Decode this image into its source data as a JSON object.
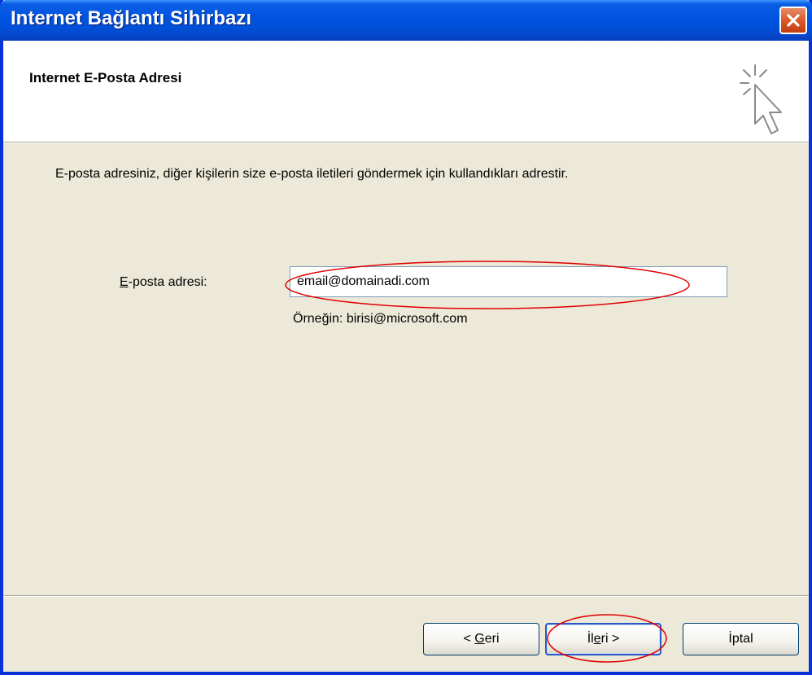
{
  "window": {
    "title": "Internet Bağlantı Sihirbazı",
    "accent_color": "#0054e3",
    "close_icon": "close-icon"
  },
  "header": {
    "title": "Internet E-Posta Adresi",
    "icon": "wizard-cursor-icon"
  },
  "body": {
    "description": "E-posta adresiniz, diğer kişilerin size e-posta iletileri göndermek için kullandıkları adrestir.",
    "email_label": "E-posta adresi:",
    "email_value": "email@domainadi.com",
    "example": "Örneğin: birisi@microsoft.com",
    "highlight_color": "#e00000"
  },
  "buttons": {
    "back": "< Geri",
    "next": "İleri >",
    "cancel": "İptal"
  }
}
